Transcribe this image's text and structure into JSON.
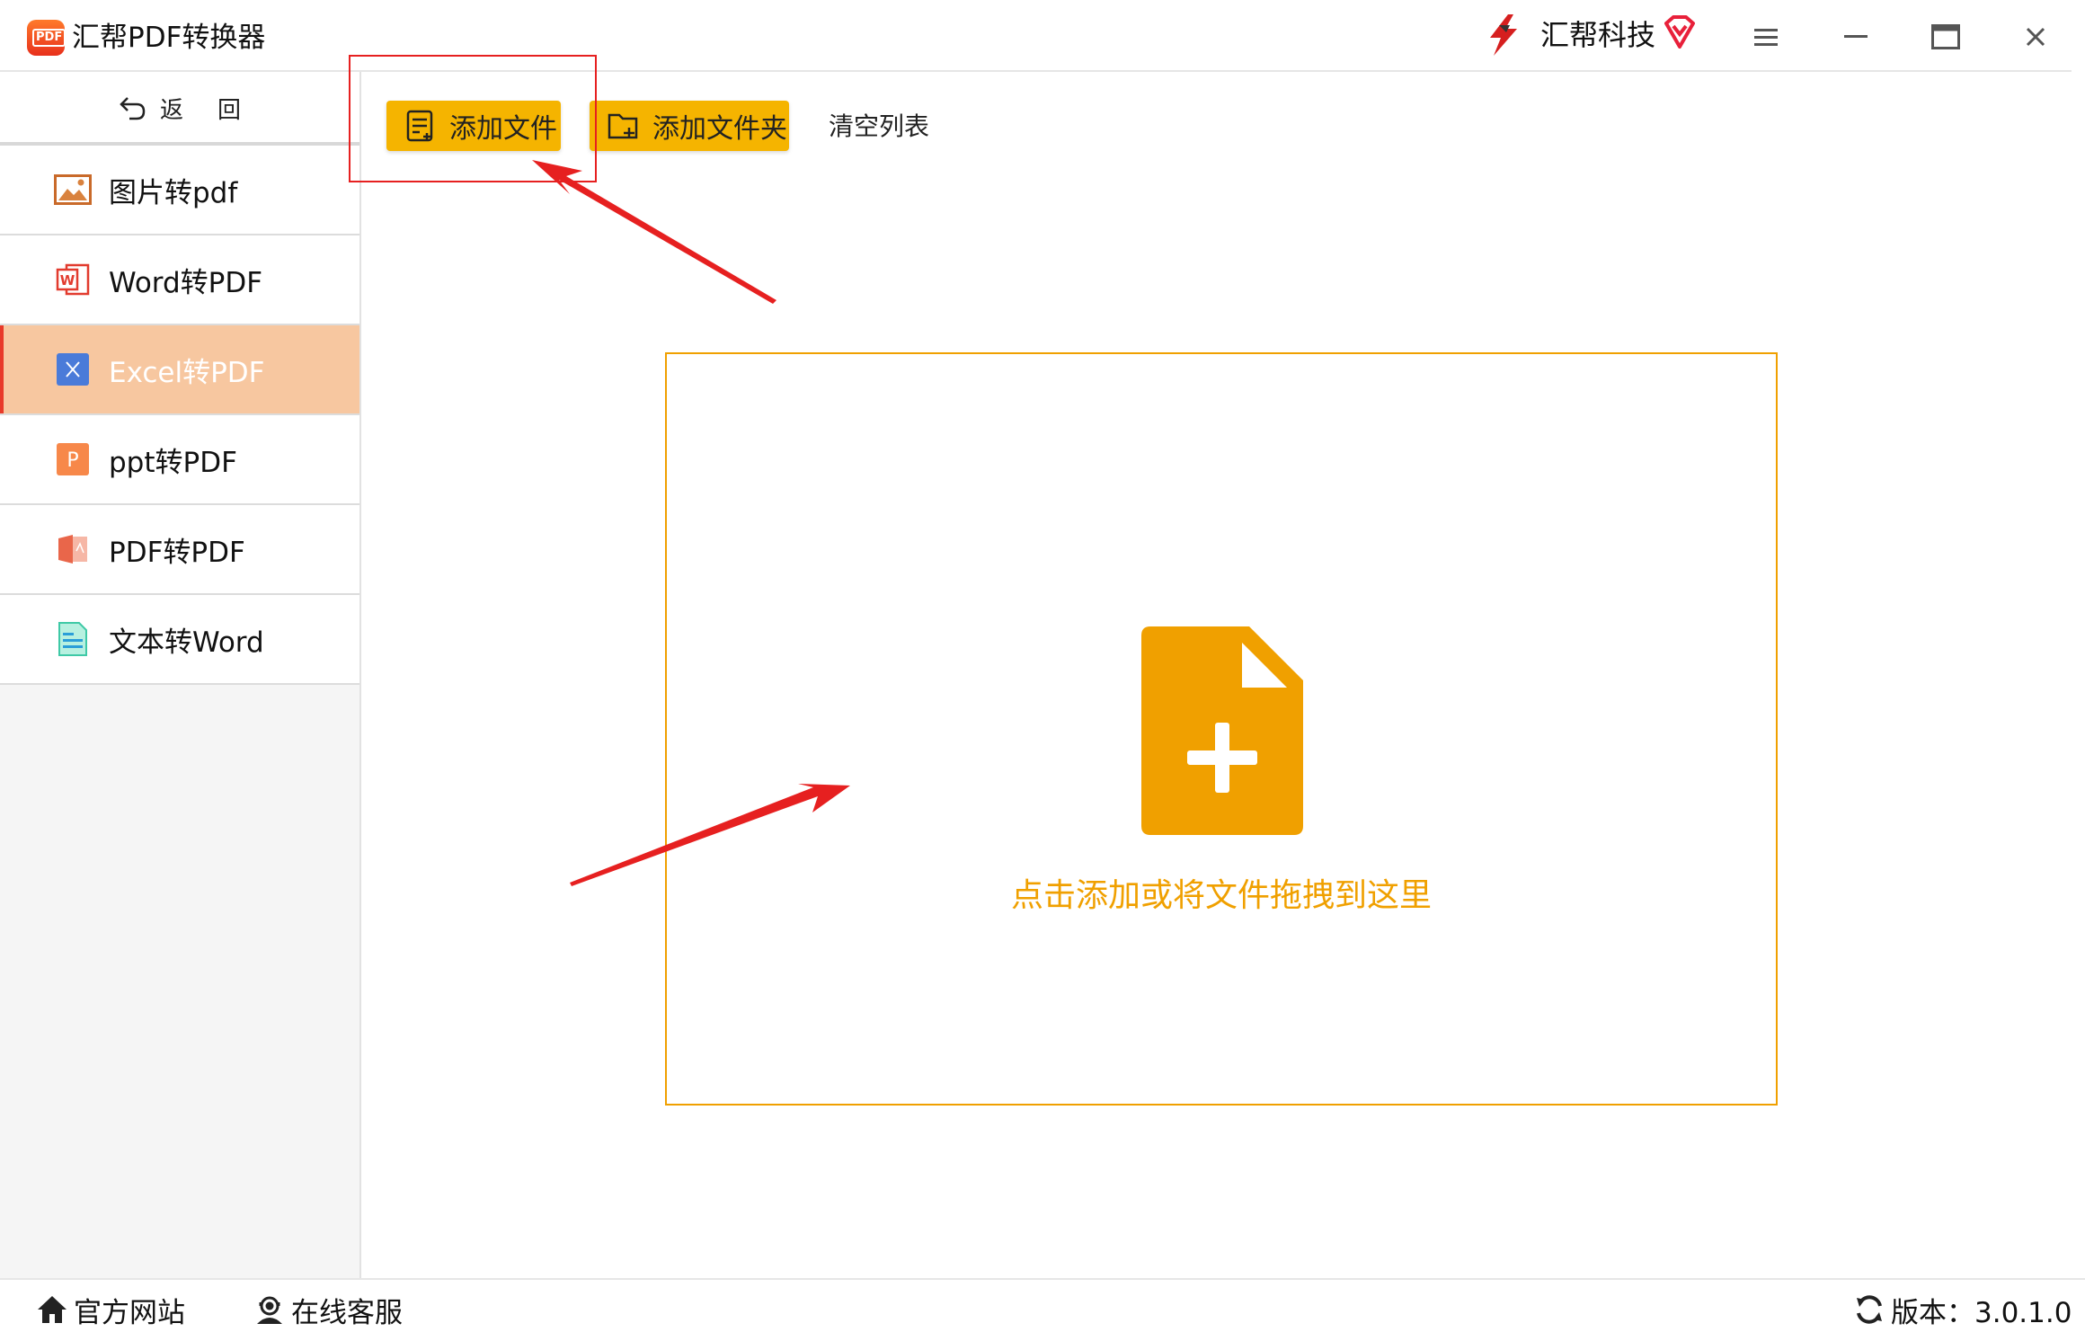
{
  "app": {
    "title": "汇帮PDF转换器",
    "logo_text": "PDF",
    "brand": "汇帮科技"
  },
  "window_controls": [
    "menu-icon",
    "minimize-icon",
    "maximize-icon",
    "close-icon"
  ],
  "sidebar": {
    "back_label_1": "返",
    "back_label_2": "回",
    "items": [
      {
        "label": "图片转pdf",
        "icon": "image-icon"
      },
      {
        "label": "Word转PDF",
        "icon": "word-icon"
      },
      {
        "label": "Excel转PDF",
        "icon": "excel-icon",
        "active": true
      },
      {
        "label": "ppt转PDF",
        "icon": "ppt-icon"
      },
      {
        "label": "PDF转PDF",
        "icon": "pdf-icon"
      },
      {
        "label": "文本转Word",
        "icon": "text-icon"
      }
    ]
  },
  "toolbar": {
    "add_file": "添加文件",
    "add_folder": "添加文件夹",
    "clear_list": "清空列表"
  },
  "dropzone": {
    "text": "点击添加或将文件拖拽到这里"
  },
  "statusbar": {
    "website": "官方网站",
    "support": "在线客服",
    "version": "版本：3.0.1.0"
  },
  "colors": {
    "accent": "#f5b400",
    "dropzone_border": "#f0a000",
    "active_item_bg": "#f7c7a0",
    "annotation": "#e62020"
  }
}
